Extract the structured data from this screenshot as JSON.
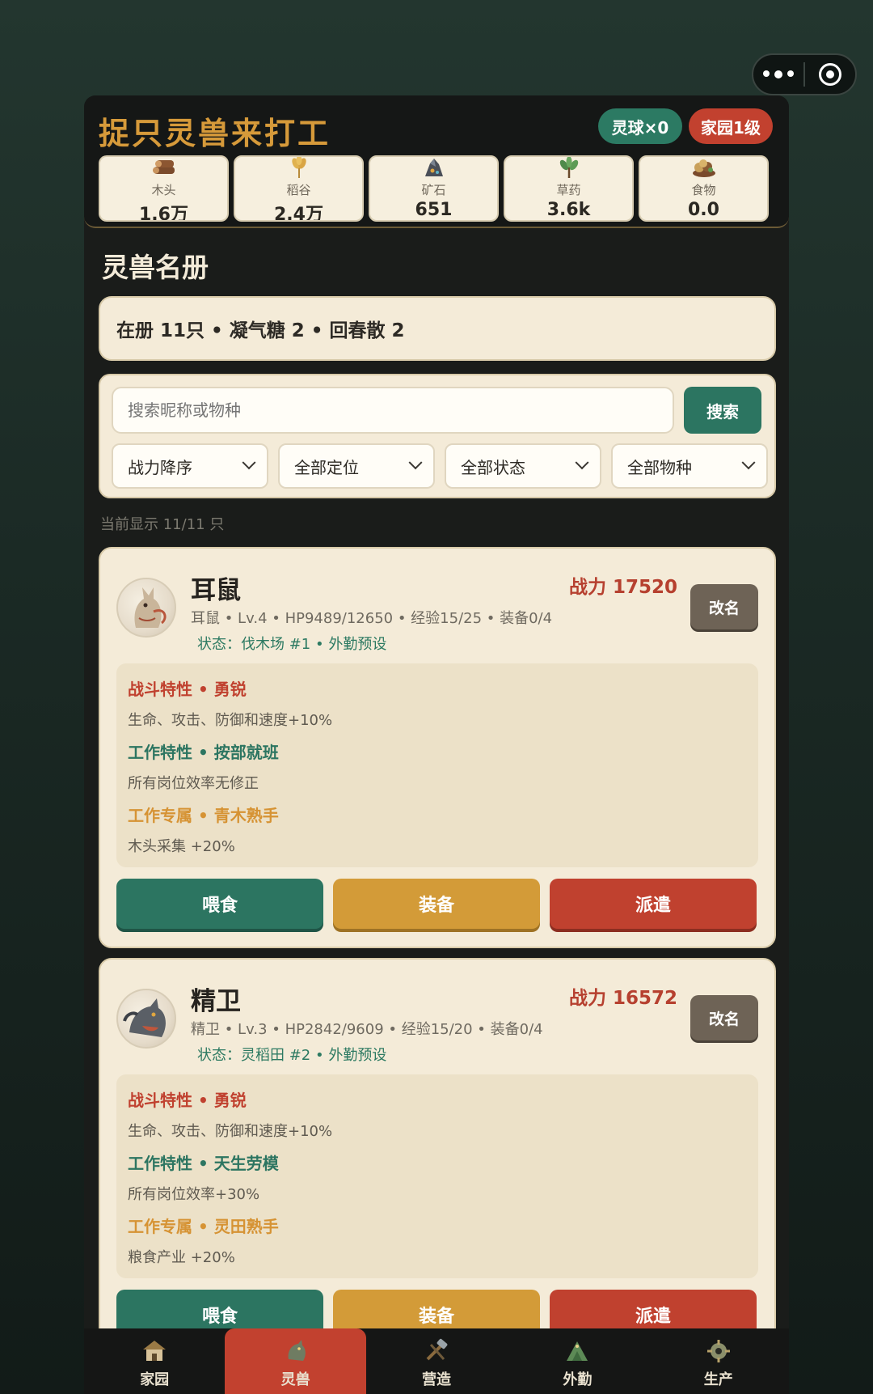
{
  "app": {
    "title": "捉只灵兽来打工",
    "badge_balls": "灵球×0",
    "badge_home": "家园1级"
  },
  "resources": [
    {
      "name": "木头",
      "value": "1.6万",
      "icon": "wood-icon"
    },
    {
      "name": "稻谷",
      "value": "2.4万",
      "icon": "rice-icon"
    },
    {
      "name": "矿石",
      "value": "651",
      "icon": "ore-icon"
    },
    {
      "name": "草药",
      "value": "3.6k",
      "icon": "herb-icon"
    },
    {
      "name": "食物",
      "value": "0.0",
      "icon": "food-icon"
    }
  ],
  "section_title": "灵兽名册",
  "summary": "在册 11只 • 凝气糖 2 • 回春散 2",
  "search": {
    "placeholder": "搜索昵称或物种",
    "button": "搜索"
  },
  "filters": {
    "sort": "战力降序",
    "role": "全部定位",
    "status": "全部状态",
    "species": "全部物种"
  },
  "count_text": "当前显示 11/11 只",
  "beasts": [
    {
      "name": "耳鼠",
      "power": "战力 17520",
      "rename": "改名",
      "stats": "耳鼠 • Lv.4 • HP9489/12650 • 经验15/25 • 装备0/4",
      "status": "状态：伐木场 #1 • 外勤预设",
      "battle_trait_title": "战斗特性 • 勇锐",
      "battle_trait_desc": "生命、攻击、防御和速度+10%",
      "work_trait_title": "工作特性 • 按部就班",
      "work_trait_desc": "所有岗位效率无修正",
      "exclusive_title": "工作专属 • 青木熟手",
      "exclusive_desc": "木头采集 +20%",
      "feed": "喂食",
      "equip": "装备",
      "dispatch": "派遣"
    },
    {
      "name": "精卫",
      "power": "战力 16572",
      "rename": "改名",
      "stats": "精卫 • Lv.3 • HP2842/9609 • 经验15/20 • 装备0/4",
      "status": "状态：灵稻田 #2 • 外勤预设",
      "battle_trait_title": "战斗特性 • 勇锐",
      "battle_trait_desc": "生命、攻击、防御和速度+10%",
      "work_trait_title": "工作特性 • 天生劳模",
      "work_trait_desc": "所有岗位效率+30%",
      "exclusive_title": "工作专属 • 灵田熟手",
      "exclusive_desc": "粮食产业 +20%",
      "feed": "喂食",
      "equip": "装备",
      "dispatch": "派遣"
    }
  ],
  "nav": [
    {
      "label": "家园",
      "icon": "home-icon",
      "active": false
    },
    {
      "label": "灵兽",
      "icon": "beast-icon",
      "active": true
    },
    {
      "label": "营造",
      "icon": "build-icon",
      "active": false
    },
    {
      "label": "外勤",
      "icon": "field-icon",
      "active": false
    },
    {
      "label": "生产",
      "icon": "production-icon",
      "active": false
    }
  ]
}
